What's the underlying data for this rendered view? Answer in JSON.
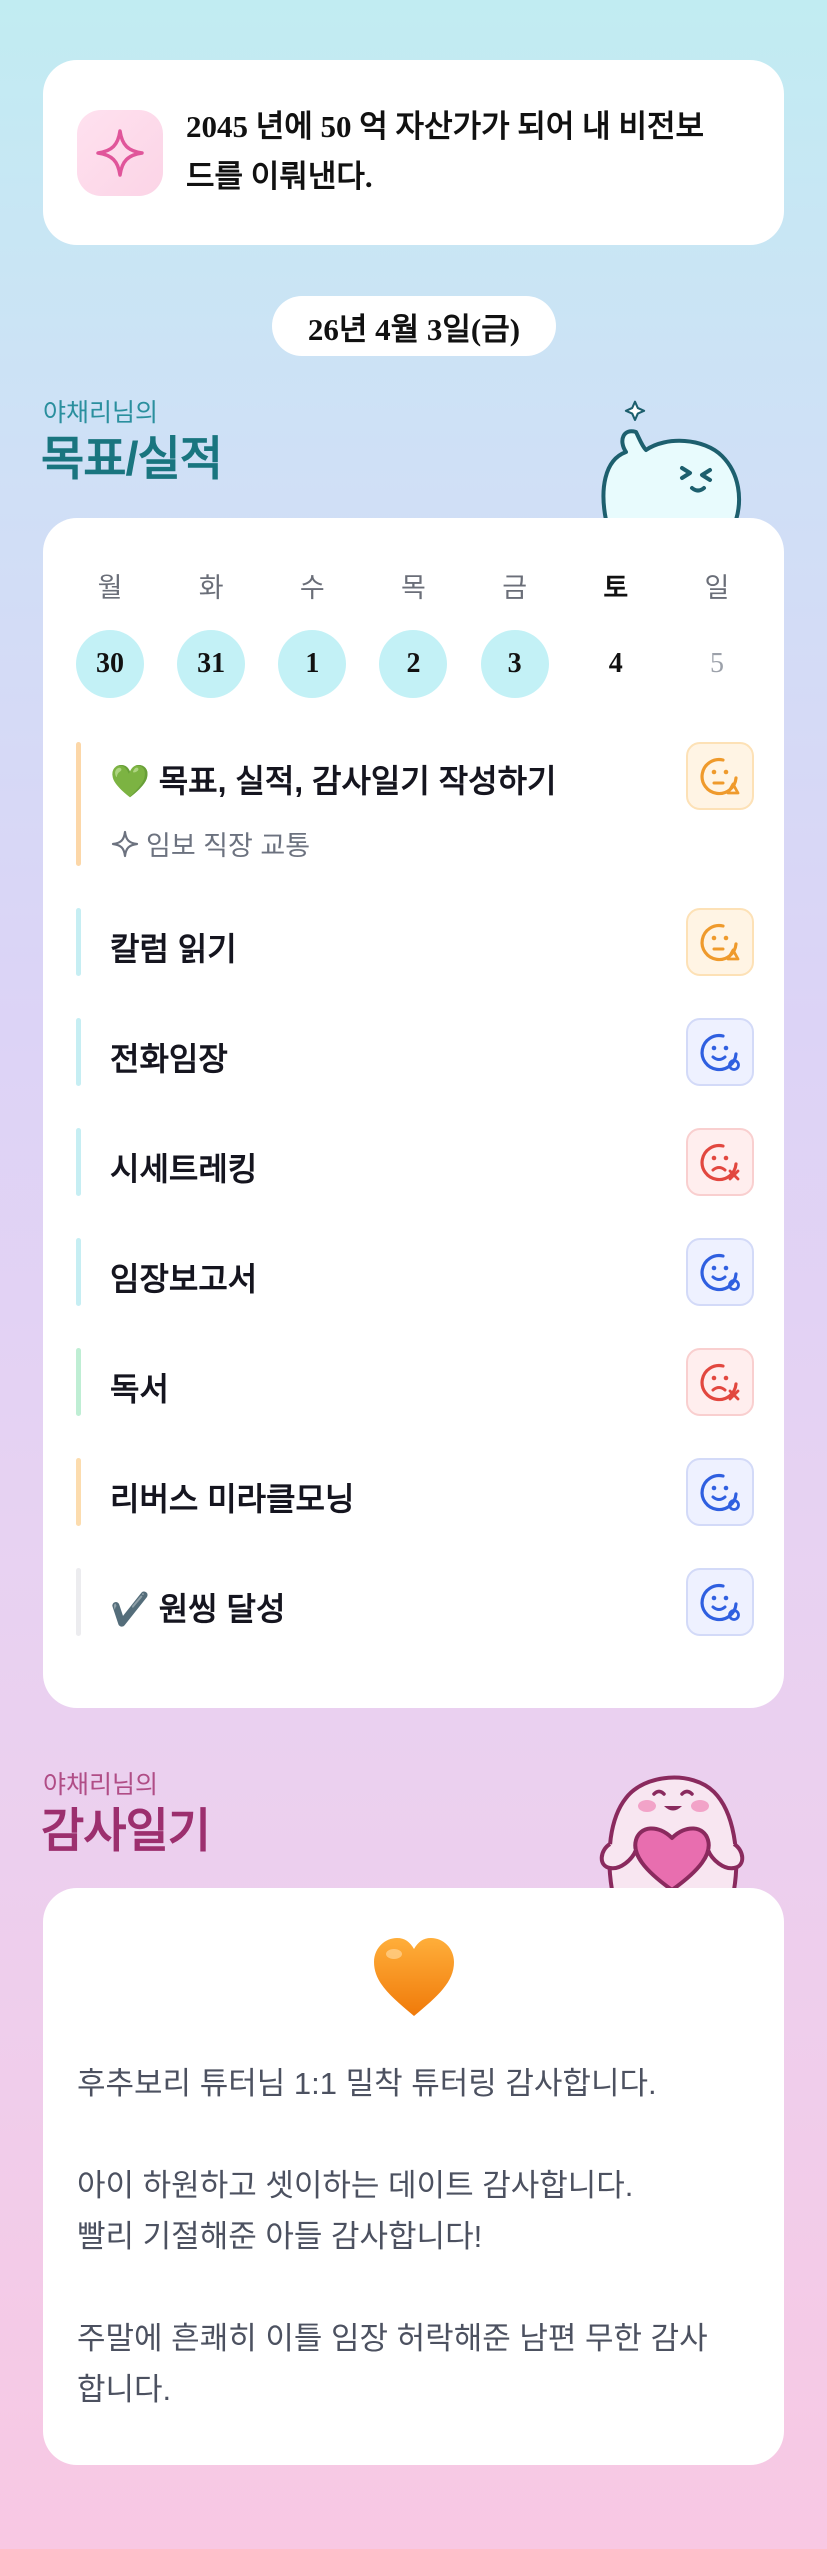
{
  "vision": {
    "icon": "sparkle-icon",
    "text": "2045 년에 50 억 자산가가 되어 내 비전보드를 이뤄낸다.",
    "line1": "2045 년에 50 억 자산가가 되어 내 비전보",
    "line2": "드를 이뤄낸다."
  },
  "date": "26년 4월 3일(금)",
  "goals_section": {
    "subtitle": "야채리님의",
    "title": "목표/실적"
  },
  "week": {
    "days": [
      {
        "name": "월",
        "num": "30",
        "done": true
      },
      {
        "name": "화",
        "num": "31",
        "done": true
      },
      {
        "name": "수",
        "num": "1",
        "done": true
      },
      {
        "name": "목",
        "num": "2",
        "done": true
      },
      {
        "name": "금",
        "num": "3",
        "done": true
      },
      {
        "name": "토",
        "num": "4",
        "done": false
      },
      {
        "name": "일",
        "num": "5",
        "done": false
      }
    ]
  },
  "tasks": [
    {
      "label": "💚 목표, 실적, 감사일기 작성하기",
      "sub": "임보 직장 교통",
      "status": "triangle",
      "bar_color": "#fcd7a8"
    },
    {
      "label": "칼럼 읽기",
      "status": "triangle",
      "bar_color": "#c6eef3"
    },
    {
      "label": "전화임장",
      "status": "circle",
      "bar_color": "#c6eef3"
    },
    {
      "label": "시세트레킹",
      "status": "x",
      "bar_color": "#c6eef3"
    },
    {
      "label": "임장보고서",
      "status": "circle",
      "bar_color": "#c6eef3"
    },
    {
      "label": "독서",
      "status": "x",
      "bar_color": "#bfeed4"
    },
    {
      "label": "리버스 미라클모닝",
      "status": "circle",
      "bar_color": "#fcdcae"
    },
    {
      "label": "✔️ 원씽 달성",
      "status": "circle",
      "bar_color": "#ececef"
    }
  ],
  "gratitude_section": {
    "subtitle": "야채리님의",
    "title": "감사일기"
  },
  "gratitude": {
    "emoji": "orange-heart-icon",
    "lines": [
      "후추보리 튜터님 1:1 밀착 튜터링 감사합니다.",
      "아이 하원하고 셋이하는 데이트 감사합니다.",
      "빨리 기절해준 아들 감사합니다!",
      "주말에 흔쾌히 이틀 임장 허락해준 남편 무한 감사",
      "합니다."
    ]
  },
  "colors": {
    "accent_teal": "#19757f",
    "accent_plum": "#9c2f6e",
    "done_day": "#c3f1f6",
    "triangle": "#ef9a2c",
    "circle": "#2f5fe0",
    "x": "#e2473f"
  }
}
